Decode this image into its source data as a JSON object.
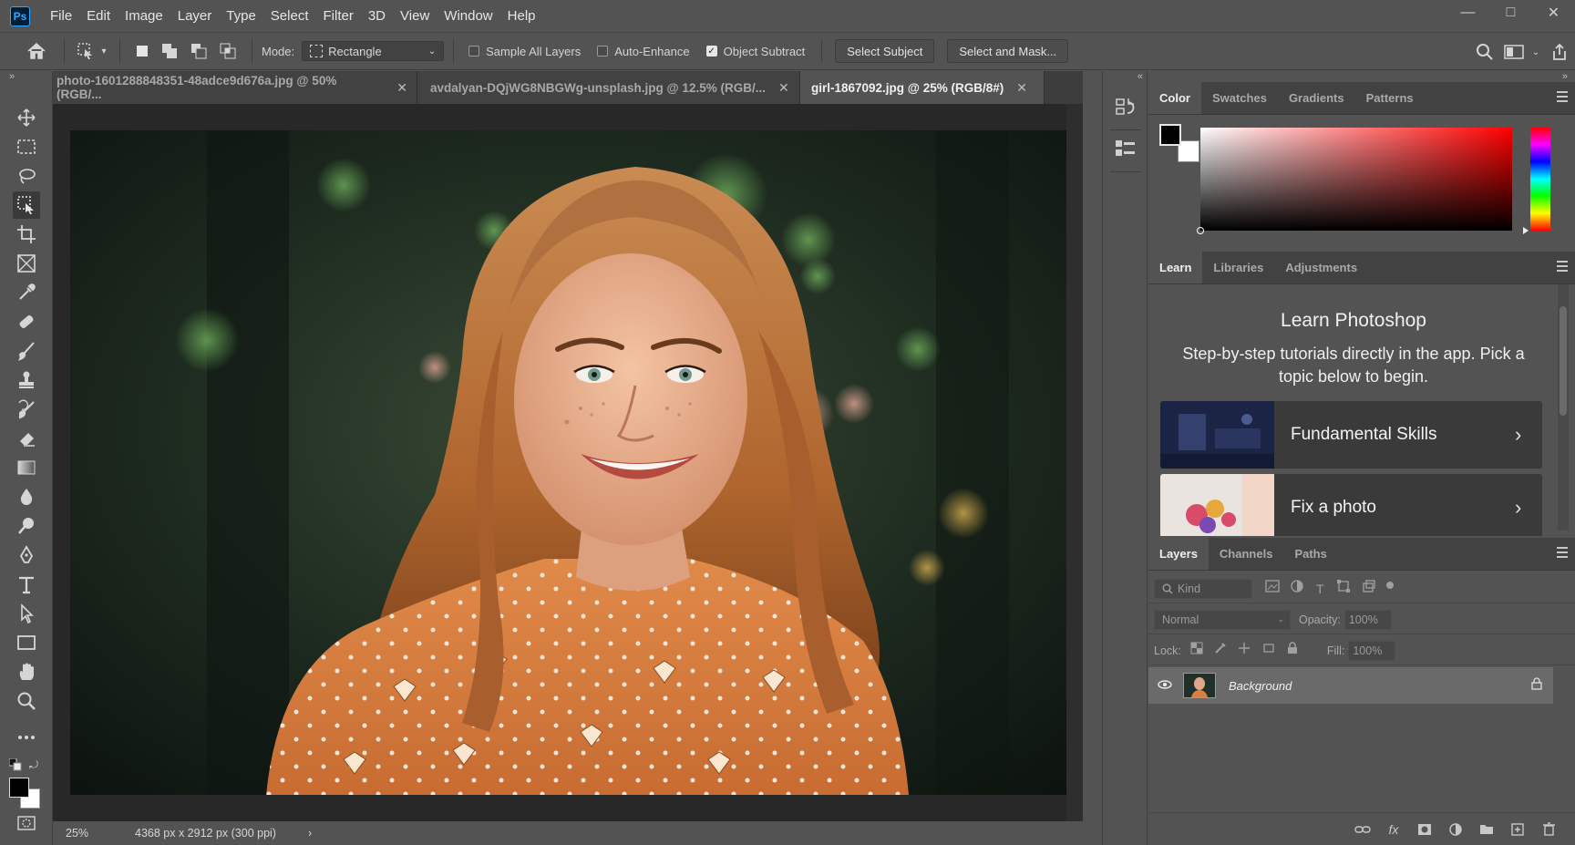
{
  "app": {
    "logo_text": "Ps"
  },
  "menu": [
    "File",
    "Edit",
    "Image",
    "Layer",
    "Type",
    "Select",
    "Filter",
    "3D",
    "View",
    "Window",
    "Help"
  ],
  "window_controls": {
    "minimize": "—",
    "maximize": "□",
    "close": "✕"
  },
  "options": {
    "mode_label": "Mode:",
    "mode_value": "Rectangle",
    "sample_all_layers": {
      "label": "Sample All Layers",
      "checked": false
    },
    "auto_enhance": {
      "label": "Auto-Enhance",
      "checked": false
    },
    "object_subtract": {
      "label": "Object Subtract",
      "checked": true
    },
    "select_subject": "Select Subject",
    "select_and_mask": "Select and Mask..."
  },
  "collapse_arrows": {
    "left": "»",
    "right": "«"
  },
  "tabs": [
    {
      "title": "photo-1601288848351-48adce9d676a.jpg @ 50% (RGB/...",
      "close": "✕",
      "active": false
    },
    {
      "title": "avdalyan-DQjWG8NBGWg-unsplash.jpg @ 12.5% (RGB/...",
      "close": "✕",
      "active": false
    },
    {
      "title": "girl-1867092.jpg @ 25% (RGB/8#)",
      "close": "✕",
      "active": true
    }
  ],
  "status": {
    "zoom": "25%",
    "doc_info": "4368 px x 2912 px (300 ppi)",
    "arrow": "›"
  },
  "panels": {
    "color_tabs": [
      "Color",
      "Swatches",
      "Gradients",
      "Patterns"
    ],
    "learn_tabs": [
      "Learn",
      "Libraries",
      "Adjustments"
    ],
    "layers_tabs": [
      "Layers",
      "Channels",
      "Paths"
    ]
  },
  "learn": {
    "title": "Learn Photoshop",
    "subtitle": "Step-by-step tutorials directly in the app. Pick a topic below to begin.",
    "cards": [
      {
        "label": "Fundamental Skills",
        "arrow": "›"
      },
      {
        "label": "Fix a photo",
        "arrow": "›"
      }
    ]
  },
  "layers": {
    "kind_placeholder": "Kind",
    "blend_mode": "Normal",
    "opacity_label": "Opacity:",
    "opacity_value": "100%",
    "lock_label": "Lock:",
    "fill_label": "Fill:",
    "fill_value": "100%",
    "background_name": "Background"
  },
  "colors": {
    "accent": "#31a8ff",
    "foreground": "#000000",
    "background": "#ffffff"
  }
}
